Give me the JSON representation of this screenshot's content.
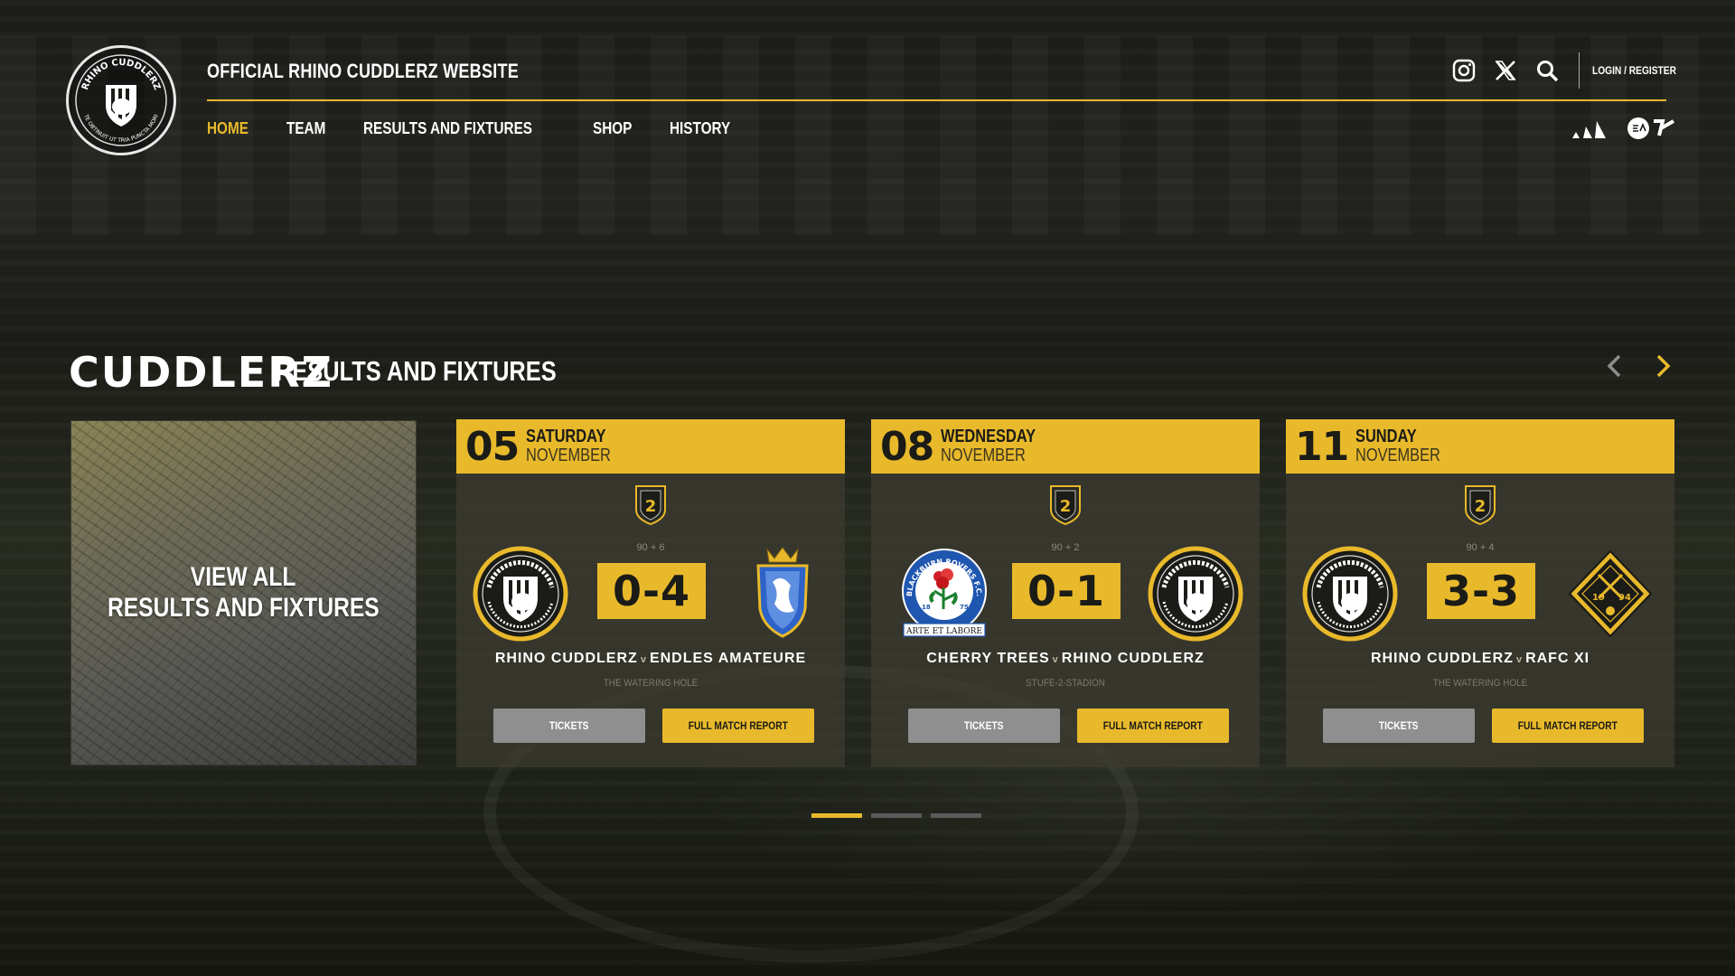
{
  "site": {
    "title": "OFFICIAL RHINO CUDDLERZ WEBSITE",
    "login_label": "LOGIN / REGISTER"
  },
  "nav": [
    {
      "label": "HOME",
      "active": true
    },
    {
      "label": "TEAM",
      "active": false
    },
    {
      "label": "RESULTS AND FIXTURES",
      "active": false
    },
    {
      "label": "SHOP",
      "active": false
    },
    {
      "label": "HISTORY",
      "active": false
    }
  ],
  "logo_text": {
    "top": "RHINO CUDDLERZ",
    "bottom": "TE OBTINUIT UT TRIA PUNCTA MORI"
  },
  "section": {
    "brand": "CUDDLERZ",
    "title": "RESULTS AND FIXTURES",
    "view_all_line1": "VIEW ALL",
    "view_all_line2": "RESULTS AND FIXTURES"
  },
  "fixtures": [
    {
      "day": "05",
      "weekday": "SATURDAY",
      "month": "NOVEMBER",
      "competition_badge": "2",
      "extra_time": "90 + 6",
      "score": "0-4",
      "home": "RHINO CUDDLERZ",
      "away": "ENDLES AMATEURE",
      "venue": "THE WATERING HOLE",
      "tickets_label": "TICKETS",
      "report_label": "FULL MATCH REPORT"
    },
    {
      "day": "08",
      "weekday": "WEDNESDAY",
      "month": "NOVEMBER",
      "competition_badge": "2",
      "extra_time": "90 + 2",
      "score": "0-1",
      "home": "CHERRY TREES",
      "away": "RHINO CUDDLERZ",
      "venue": "STUFE-2-STADION",
      "home_crest_top": "BLACKBURN ROVERS F.C.",
      "home_crest_year_left": "18",
      "home_crest_year_right": "75",
      "home_crest_motto": "ARTE ET LABORE",
      "tickets_label": "TICKETS",
      "report_label": "FULL MATCH REPORT"
    },
    {
      "day": "11",
      "weekday": "SUNDAY",
      "month": "NOVEMBER",
      "competition_badge": "2",
      "extra_time": "90 + 4",
      "score": "3-3",
      "home": "RHINO CUDDLERZ",
      "away": "RAFC XI",
      "venue": "THE WATERING HOLE",
      "away_crest_year_left": "19",
      "away_crest_year_right": "94",
      "tickets_label": "TICKETS",
      "report_label": "FULL MATCH REPORT"
    }
  ],
  "pagination": {
    "count": 3,
    "active": 1
  },
  "colors": {
    "accent": "#e8b92b",
    "card_bg": "#3e3c32",
    "button_grey": "#8f8f8f"
  },
  "icons": [
    "instagram-icon",
    "x-icon",
    "search-icon",
    "chevron-left-icon",
    "chevron-right-icon",
    "adidas-logo",
    "ea-sports-logo"
  ]
}
